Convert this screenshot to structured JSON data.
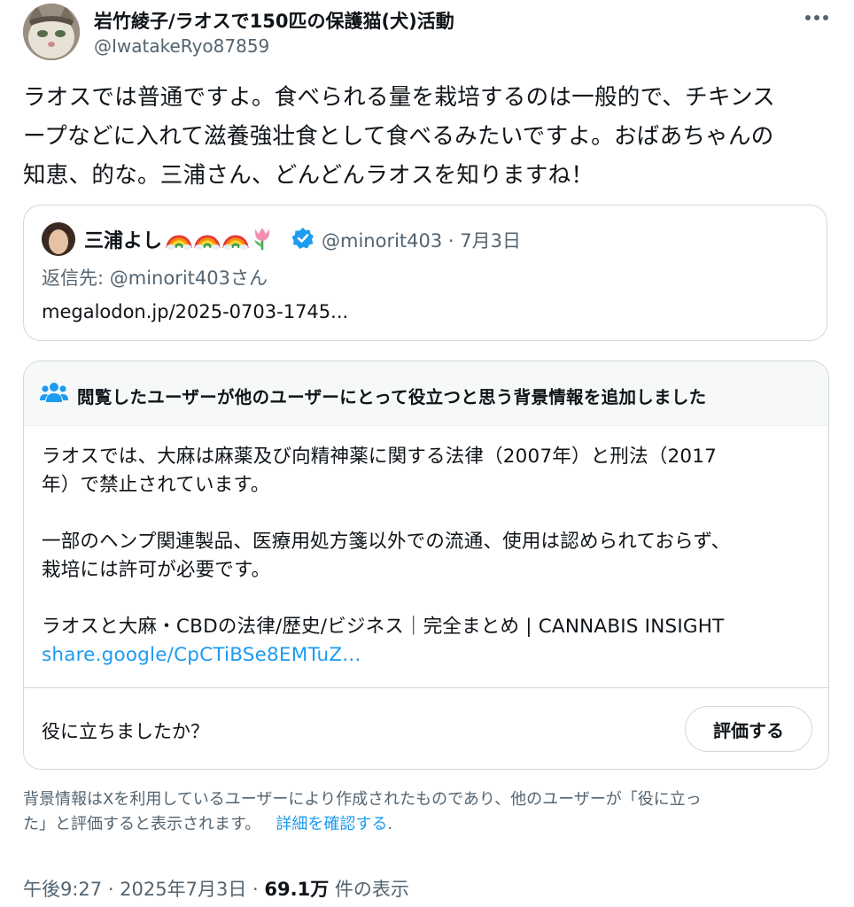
{
  "author": {
    "display_name": "岩竹綾子/ラオスで150匹の保護猫(犬)活動",
    "handle": "@IwatakeRyo87859"
  },
  "tweet": {
    "text_lines": [
      "ラオスでは普通ですよ。食べられる量を栽培するのは一般的で、チキンス",
      "ープなどに入れて滋養強壮食として食べるみたいですよ。おばあちゃんの",
      "知恵、的な。三浦さん、どんどんラオスを知りますね！"
    ]
  },
  "quoted": {
    "display_name": "三浦よし",
    "emojis": [
      "rainbow",
      "rainbow",
      "rainbow",
      "tulip"
    ],
    "handle_date": "@minorit403 · 7月3日",
    "reply_to": "返信先: @minorit403さん",
    "link": "megalodon.jp/2025-0703-1745..."
  },
  "note": {
    "title": "閲覧したユーザーが他のユーザーにとって役立つと思う背景情報を追加しました",
    "paragraph1": [
      "ラオスでは、大麻は麻薬及び向精神薬に関する法律（2007年）と刑法（2017",
      "年）で禁止されています。"
    ],
    "paragraph2": [
      "一部のヘンプ関連製品、医療用処方箋以外での流通、使用は認められておらず、",
      "栽培には許可が必要です。"
    ],
    "source_title": "ラオスと大麻・CBDの法律/歴史/ビジネス｜完全まとめ | CANNABIS INSIGHT",
    "source_url": "share.google/CpCTiBSe8EMTuZ...",
    "helpful_question": "役に立ちましたか？",
    "rate_button": "評価する"
  },
  "disclaimer": {
    "line1": "背景情報はXを利用しているユーザーにより作成されたものであり、他のユーザーが「役に立っ",
    "line2": "た」と評価すると表示されます。",
    "details_link": "詳細を確認する",
    "period": "."
  },
  "meta": {
    "time_date": "午後9:27 · 2025年7月3日 · ",
    "views": "69.1万",
    "views_suffix": " 件の表示"
  },
  "colors": {
    "accent": "#1d9bf0",
    "secondary_text": "#536471",
    "border": "#cfd9de"
  }
}
